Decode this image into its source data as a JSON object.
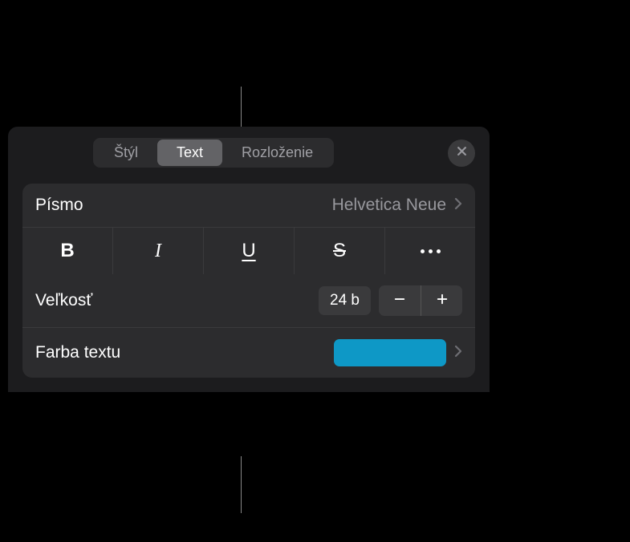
{
  "tabs": {
    "style": "Štýl",
    "text": "Text",
    "layout": "Rozloženie"
  },
  "font": {
    "label": "Písmo",
    "value": "Helvetica Neue"
  },
  "format": {
    "bold": "B",
    "italic": "I",
    "underline": "U",
    "strike": "S"
  },
  "size": {
    "label": "Veľkosť",
    "value": "24 b"
  },
  "color": {
    "label": "Farba textu",
    "value": "#0e98c6"
  }
}
